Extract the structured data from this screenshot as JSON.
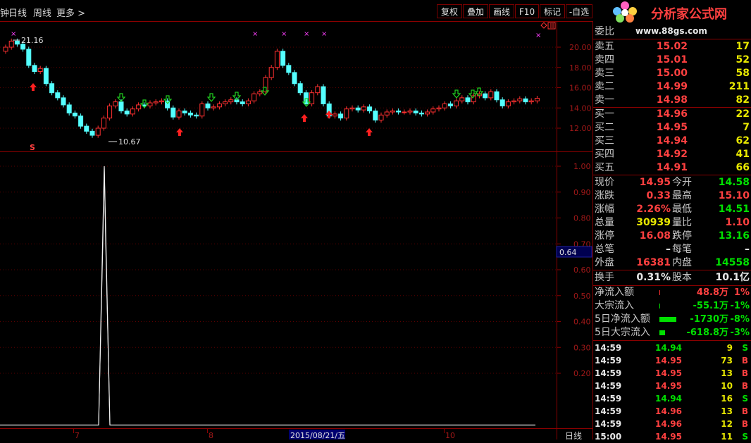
{
  "toolbar": {
    "tabs": [
      "钟",
      "日线",
      "周线",
      "更多 >"
    ],
    "buttons": [
      "复权",
      "叠加",
      "画线",
      "F10",
      "标记",
      "-自选"
    ]
  },
  "logo": {
    "title": "分析家公式网",
    "url": "www.88gs.com"
  },
  "main_chart": {
    "y_ticks": [
      "20.00",
      "18.00",
      "16.00",
      "14.00",
      "12.00"
    ],
    "high_label": "21.16",
    "low_label": "10.67",
    "s_mark": "S"
  },
  "indicator": {
    "y_ticks": [
      "1.00",
      "0.90",
      "0.80",
      "0.70",
      "0.60",
      "0.50",
      "0.40",
      "0.30",
      "0.20"
    ],
    "current_value": "0.64"
  },
  "x_axis": {
    "labels": [
      "7",
      "8",
      "2015/08/21/五",
      "10"
    ],
    "period_button": "日线"
  },
  "orderbook": {
    "header": "委比",
    "sell": [
      {
        "label": "卖五",
        "price": "15.02",
        "vol": "17"
      },
      {
        "label": "卖四",
        "price": "15.01",
        "vol": "52"
      },
      {
        "label": "卖三",
        "price": "15.00",
        "vol": "58"
      },
      {
        "label": "卖二",
        "price": "14.99",
        "vol": "211"
      },
      {
        "label": "卖一",
        "price": "14.98",
        "vol": "82"
      }
    ],
    "buy": [
      {
        "label": "买一",
        "price": "14.96",
        "vol": "22"
      },
      {
        "label": "买二",
        "price": "14.95",
        "vol": "7"
      },
      {
        "label": "买三",
        "price": "14.94",
        "vol": "62"
      },
      {
        "label": "买四",
        "price": "14.92",
        "vol": "41"
      },
      {
        "label": "买五",
        "price": "14.91",
        "vol": "66"
      }
    ]
  },
  "quote": [
    {
      "l1": "现价",
      "v1": "14.95",
      "l2": "今开",
      "v2": "14.58"
    },
    {
      "l1": "涨跌",
      "v1": "0.33",
      "l2": "最高",
      "v2": "15.10"
    },
    {
      "l1": "涨幅",
      "v1": "2.26%",
      "l2": "最低",
      "v2": "14.51"
    },
    {
      "l1": "总量",
      "v1": "30939",
      "l2": "量比",
      "v2": "1.10"
    },
    {
      "l1": "涨停",
      "v1": "16.08",
      "l2": "跌停",
      "v2": "13.16"
    },
    {
      "l1": "总笔",
      "v1": "–",
      "l2": "每笔",
      "v2": "–"
    },
    {
      "l1": "外盘",
      "v1": "16381",
      "l2": "内盘",
      "v2": "14558"
    }
  ],
  "turnover": {
    "l1": "换手",
    "v1": "0.31%",
    "l2": "股本",
    "v2": "10.1亿"
  },
  "flows": [
    {
      "label": "净流入额",
      "value": "48.8万",
      "pct": "1%"
    },
    {
      "label": "大宗流入",
      "value": "-55.1万",
      "pct": "-1%"
    },
    {
      "label": "5日净流入额",
      "value": "-1730万",
      "pct": "-8%"
    },
    {
      "label": "5日大宗流入",
      "value": "-618.8万",
      "pct": "-3%"
    }
  ],
  "ticks": [
    {
      "time": "14:59",
      "price": "14.94",
      "vol": "9",
      "side": "S"
    },
    {
      "time": "14:59",
      "price": "14.95",
      "vol": "73",
      "side": "B"
    },
    {
      "time": "14:59",
      "price": "14.95",
      "vol": "13",
      "side": "B"
    },
    {
      "time": "14:59",
      "price": "14.95",
      "vol": "10",
      "side": "B"
    },
    {
      "time": "14:59",
      "price": "14.94",
      "vol": "16",
      "side": "S"
    },
    {
      "time": "14:59",
      "price": "14.96",
      "vol": "13",
      "side": "B"
    },
    {
      "time": "14:59",
      "price": "14.96",
      "vol": "12",
      "side": "B"
    },
    {
      "time": "15:00",
      "price": "14.95",
      "vol": "11",
      "side": "S"
    }
  ],
  "colors": {
    "up": "#ff3030",
    "down": "#54ffff",
    "grid": "#8a0000",
    "buy_arrow": "#ff2020",
    "sell_arrow": "#20d020"
  }
}
